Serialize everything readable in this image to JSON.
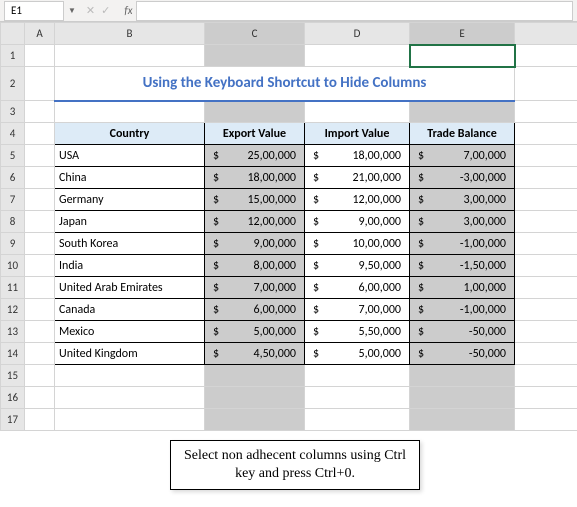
{
  "nameBox": "E1",
  "fx": {
    "cancel": "✕",
    "confirm": "✓",
    "label": "fx"
  },
  "colHeaders": [
    "A",
    "B",
    "C",
    "D",
    "E"
  ],
  "rowHeaders": [
    "1",
    "2",
    "3",
    "4",
    "5",
    "6",
    "7",
    "8",
    "9",
    "10",
    "11",
    "12",
    "13",
    "14",
    "15",
    "16",
    "17"
  ],
  "title": "Using the Keyboard Shortcut to Hide Columns",
  "headers": {
    "country": "Country",
    "export": "Export Value",
    "import": "Import Value",
    "balance": "Trade Balance"
  },
  "currency": "$",
  "rows": [
    {
      "country": "USA",
      "export": "25,00,000",
      "import": "18,00,000",
      "balance": "7,00,000"
    },
    {
      "country": "China",
      "export": "18,00,000",
      "import": "21,00,000",
      "balance": "-3,00,000"
    },
    {
      "country": "Germany",
      "export": "15,00,000",
      "import": "12,00,000",
      "balance": "3,00,000"
    },
    {
      "country": "Japan",
      "export": "12,00,000",
      "import": "9,00,000",
      "balance": "3,00,000"
    },
    {
      "country": "South Korea",
      "export": "9,00,000",
      "import": "10,00,000",
      "balance": "-1,00,000"
    },
    {
      "country": "India",
      "export": "8,00,000",
      "import": "9,50,000",
      "balance": "-1,50,000"
    },
    {
      "country": "United Arab Emirates",
      "export": "7,00,000",
      "import": "6,00,000",
      "balance": "1,00,000"
    },
    {
      "country": "Canada",
      "export": "6,00,000",
      "import": "7,00,000",
      "balance": "-1,00,000"
    },
    {
      "country": "Mexico",
      "export": "5,00,000",
      "import": "5,50,000",
      "balance": "-50,000"
    },
    {
      "country": "United Kingdom",
      "export": "4,50,000",
      "import": "5,00,000",
      "balance": "-50,000"
    }
  ],
  "callout": "Select non adhecent columns using Ctrl key and press Ctrl+0.",
  "chart_data": {
    "type": "table",
    "title": "Using the Keyboard Shortcut to Hide Columns",
    "columns": [
      "Country",
      "Export Value",
      "Import Value",
      "Trade Balance"
    ],
    "series": [
      {
        "name": "Export Value",
        "values": [
          2500000,
          1800000,
          1500000,
          1200000,
          900000,
          800000,
          700000,
          600000,
          500000,
          450000
        ]
      },
      {
        "name": "Import Value",
        "values": [
          1800000,
          2100000,
          1200000,
          900000,
          1000000,
          950000,
          600000,
          700000,
          550000,
          500000
        ]
      },
      {
        "name": "Trade Balance",
        "values": [
          700000,
          -300000,
          300000,
          300000,
          -100000,
          -150000,
          100000,
          -100000,
          -50000,
          -50000
        ]
      }
    ],
    "categories": [
      "USA",
      "China",
      "Germany",
      "Japan",
      "South Korea",
      "India",
      "United Arab Emirates",
      "Canada",
      "Mexico",
      "United Kingdom"
    ]
  }
}
